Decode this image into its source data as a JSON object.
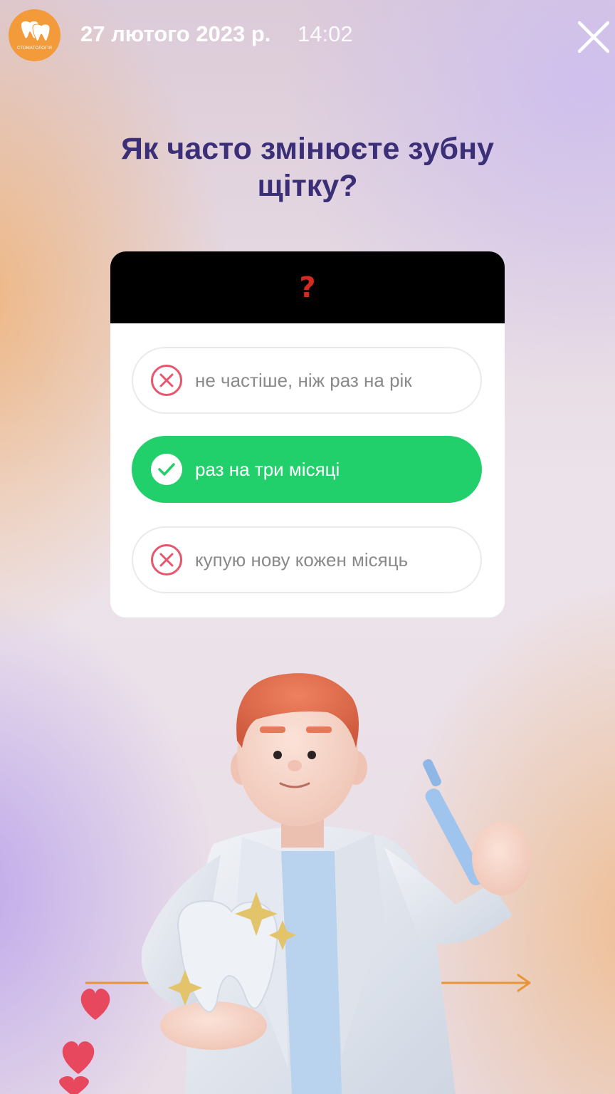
{
  "story": {
    "date": "27 лютого 2023 р.",
    "time": "14:02",
    "close_icon": "close-icon"
  },
  "profile": {
    "avatar_text": "СТОМАТОЛОГІЯ",
    "brand_color": "#f39a3a"
  },
  "quiz": {
    "question": "Як часто змінюєте зубну щітку?",
    "header_symbol": "?",
    "options": [
      {
        "label": "не частіше, ніж раз на рік",
        "state": "wrong",
        "icon": "x-circle-icon"
      },
      {
        "label": "раз на три місяці",
        "state": "correct",
        "icon": "check-circle-icon"
      },
      {
        "label": "купую нову кожен місяць",
        "state": "wrong",
        "icon": "x-circle-icon"
      }
    ],
    "colors": {
      "correct": "#21cf6b",
      "wrong": "#e8566e",
      "question": "#3b2f77",
      "header_symbol": "#d42a1e"
    }
  }
}
